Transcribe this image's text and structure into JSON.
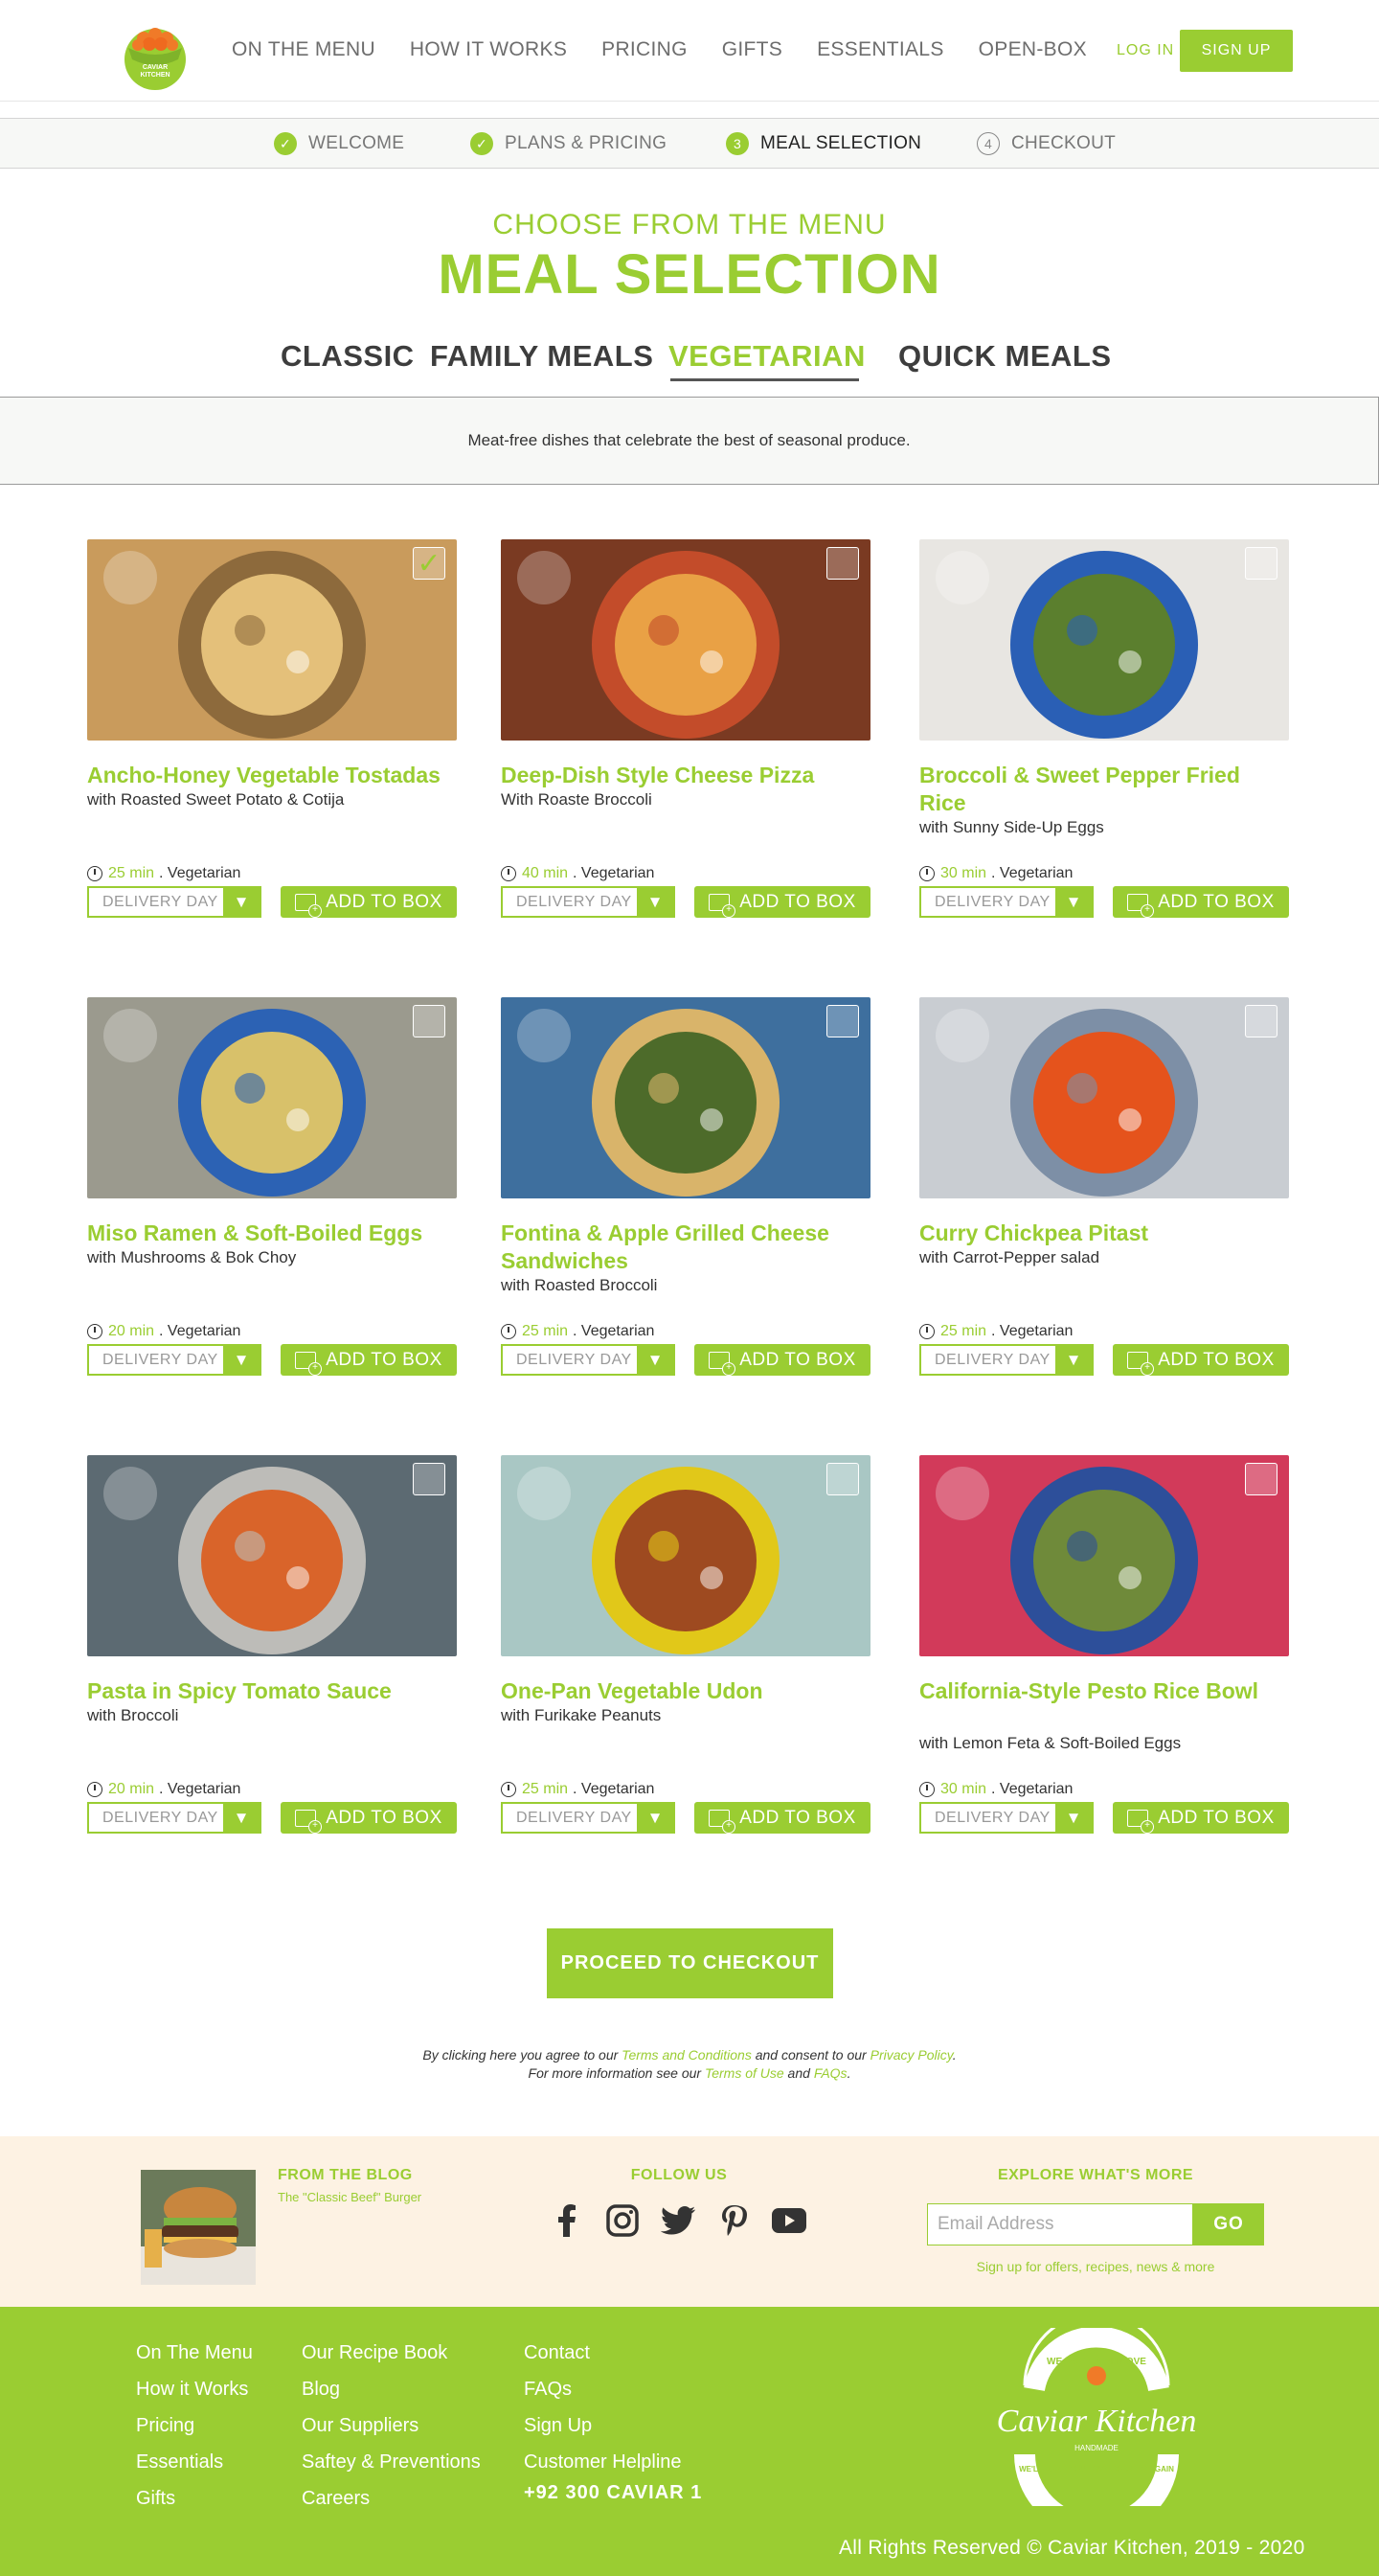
{
  "header": {
    "logo_text": "CAVIAR KITCHEN",
    "nav": [
      "ON THE MENU",
      "HOW IT WORKS",
      "PRICING",
      "GIFTS",
      "ESSENTIALS",
      "OPEN-BOX"
    ],
    "login": "LOG IN",
    "signup": "SIGN UP"
  },
  "steps": [
    {
      "label": "WELCOME",
      "state": "done",
      "mark": "✓"
    },
    {
      "label": "PLANS & PRICING",
      "state": "done",
      "mark": "✓"
    },
    {
      "label": "MEAL SELECTION",
      "state": "current",
      "mark": "3"
    },
    {
      "label": "CHECKOUT",
      "state": "todo",
      "mark": "4"
    }
  ],
  "page": {
    "subtitle": "CHOOSE FROM THE MENU",
    "title": "MEAL SELECTION",
    "tabs": [
      "CLASSIC",
      "FAMILY MEALS",
      "VEGETARIAN",
      "QUICK MEALS"
    ],
    "active_tab": "VEGETARIAN",
    "description": "Meat-free dishes that celebrate the best of seasonal produce."
  },
  "meals": [
    {
      "name": "Ancho-Honey Vegetable Tostadas",
      "with": "with Roasted Sweet Potato & Cotija",
      "time": "25 min",
      "diet": ". Vegetarian",
      "selected": true
    },
    {
      "name": "Deep-Dish Style Cheese Pizza",
      "with": "With Roaste Broccoli",
      "time": "40 min",
      "diet": ". Vegetarian",
      "selected": false
    },
    {
      "name": "Broccoli & Sweet Pepper Fried Rice",
      "with": "with Sunny Side-Up Eggs",
      "time": "30 min",
      "diet": ". Vegetarian",
      "selected": false
    },
    {
      "name": "Miso Ramen & Soft-Boiled Eggs",
      "with": "with Mushrooms & Bok Choy",
      "time": "20 min",
      "diet": ". Vegetarian",
      "selected": false
    },
    {
      "name": "Fontina & Apple Grilled Cheese Sandwiches",
      "with": "with Roasted Broccoli",
      "time": "25 min",
      "diet": ". Vegetarian",
      "selected": false
    },
    {
      "name": "Curry Chickpea Pitast",
      "with": "with Carrot-Pepper salad",
      "time": "25 min",
      "diet": ". Vegetarian",
      "selected": false
    },
    {
      "name": "Pasta in Spicy Tomato Sauce",
      "with": "with Broccoli",
      "time": "20 min",
      "diet": ". Vegetarian",
      "selected": false
    },
    {
      "name": "One-Pan Vegetable Udon",
      "with": "with Furikake Peanuts",
      "time": "25 min",
      "diet": ". Vegetarian",
      "selected": false
    },
    {
      "name": "California-Style Pesto Rice Bowl",
      "with": "with Lemon Feta & Soft-Boiled Eggs",
      "time": "30 min",
      "diet": ". Vegetarian",
      "selected": false
    }
  ],
  "card_controls": {
    "delivery_day": "DELIVERY DAY",
    "add_to_box": "ADD TO BOX"
  },
  "checkout": {
    "button": "PROCEED TO CHECKOUT",
    "legal_1a": "By clicking here you agree to our ",
    "legal_1b": "Terms and Conditions",
    "legal_1c": " and consent to our ",
    "legal_1d": "Privacy Policy",
    "legal_1e": ".",
    "legal_2a": "For more information see our ",
    "legal_2b": "Terms of Use",
    "legal_2c": " and ",
    "legal_2d": "FAQs",
    "legal_2e": "."
  },
  "band": {
    "blog_heading": "FROM THE BLOG",
    "blog_title": "The \"Classic Beef\" Burger",
    "follow_heading": "FOLLOW US",
    "socials": [
      "facebook-icon",
      "instagram-icon",
      "twitter-icon",
      "pinterest-icon",
      "youtube-icon"
    ],
    "explore_heading": "EXPLORE WHAT'S MORE",
    "email_placeholder": "Email Address",
    "go": "GO",
    "signup_note": "Sign up for offers, recipes, news & more"
  },
  "footer": {
    "col1": [
      "On The Menu",
      "How it Works",
      "Pricing",
      "Essentials",
      "Gifts"
    ],
    "col2": [
      "Our Recipe Book",
      "Blog",
      "Our Suppliers",
      "Saftey & Preventions",
      "Careers"
    ],
    "col3": [
      "Contact",
      "FAQs",
      "Sign Up",
      "Customer Helpline"
    ],
    "phone": "+92 300 CAVIAR 1",
    "logo_top": "WE DO IT WITH LOVE",
    "logo_name": "Caviar Kitchen",
    "logo_mid": "HANDMADE",
    "logo_bottom": "WE'LL MAKE YOU LOVE COOKING AGAIN",
    "copyright": "All Rights Reserved © Caviar Kitchen, 2019 - 2020"
  },
  "colors": {
    "accent": "#9acd32",
    "band": "#fdf2e3",
    "text": "#333333"
  }
}
